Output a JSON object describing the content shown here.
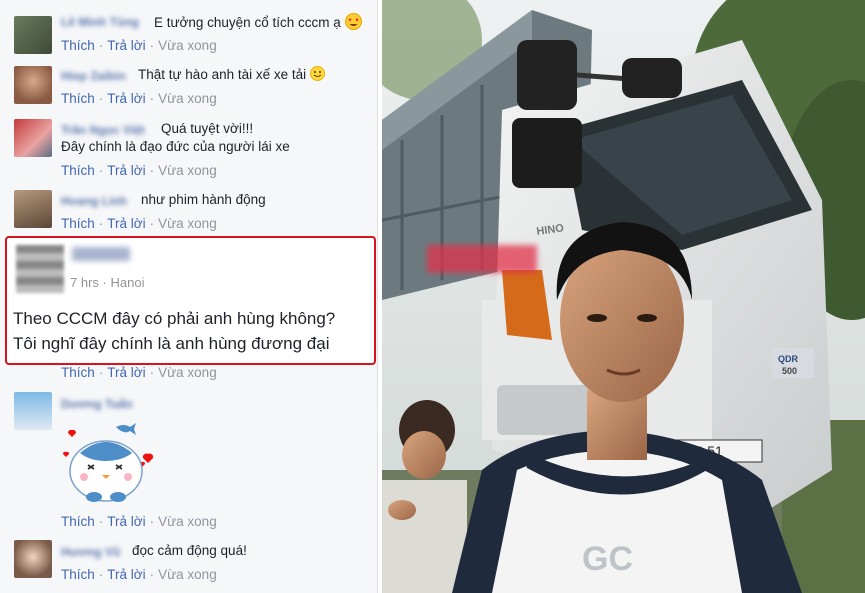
{
  "comments": [
    {
      "name": "Lê Minh Tùng",
      "text": "E tưởng chuyện cổ tích cccm ạ",
      "emoji": "heart-eyes-icon"
    },
    {
      "name": "Hiep Zaibin",
      "text": "Thật tự hào anh tài xế xe tải",
      "emoji": "smile-icon"
    },
    {
      "name": "Trần Ngọc Việt",
      "text": "Quá tuyệt vời!!!",
      "text2": "Đây chính là đạo đức của người lái xe"
    },
    {
      "name": "Hoang Linh",
      "text": "như phim hành động"
    },
    {
      "name": "Dương Tuấn",
      "sticker": "blue-bird-sticker"
    },
    {
      "name": "Hương Vũ",
      "text": "đọc cảm động quá!"
    }
  ],
  "highlighted": {
    "time": "7 hrs",
    "location": "Hanoi",
    "line1": "Theo CCCM đây có phải anh hùng không?",
    "line2": "Tôi nghĩ đây chính là anh hùng đương đại"
  },
  "actions": {
    "like": "Thích",
    "reply": "Trả lời",
    "time": "Vừa xong",
    "sep": "·"
  },
  "photo": {
    "truck_brand": "HINO",
    "truck_model": "500",
    "badge": "QDR",
    "plate_partial": "398.51",
    "shirt_text": "GC"
  },
  "colors": {
    "link": "#4267b2",
    "highlight_border": "#d8121e",
    "panel_bg": "#f6f7f9"
  }
}
